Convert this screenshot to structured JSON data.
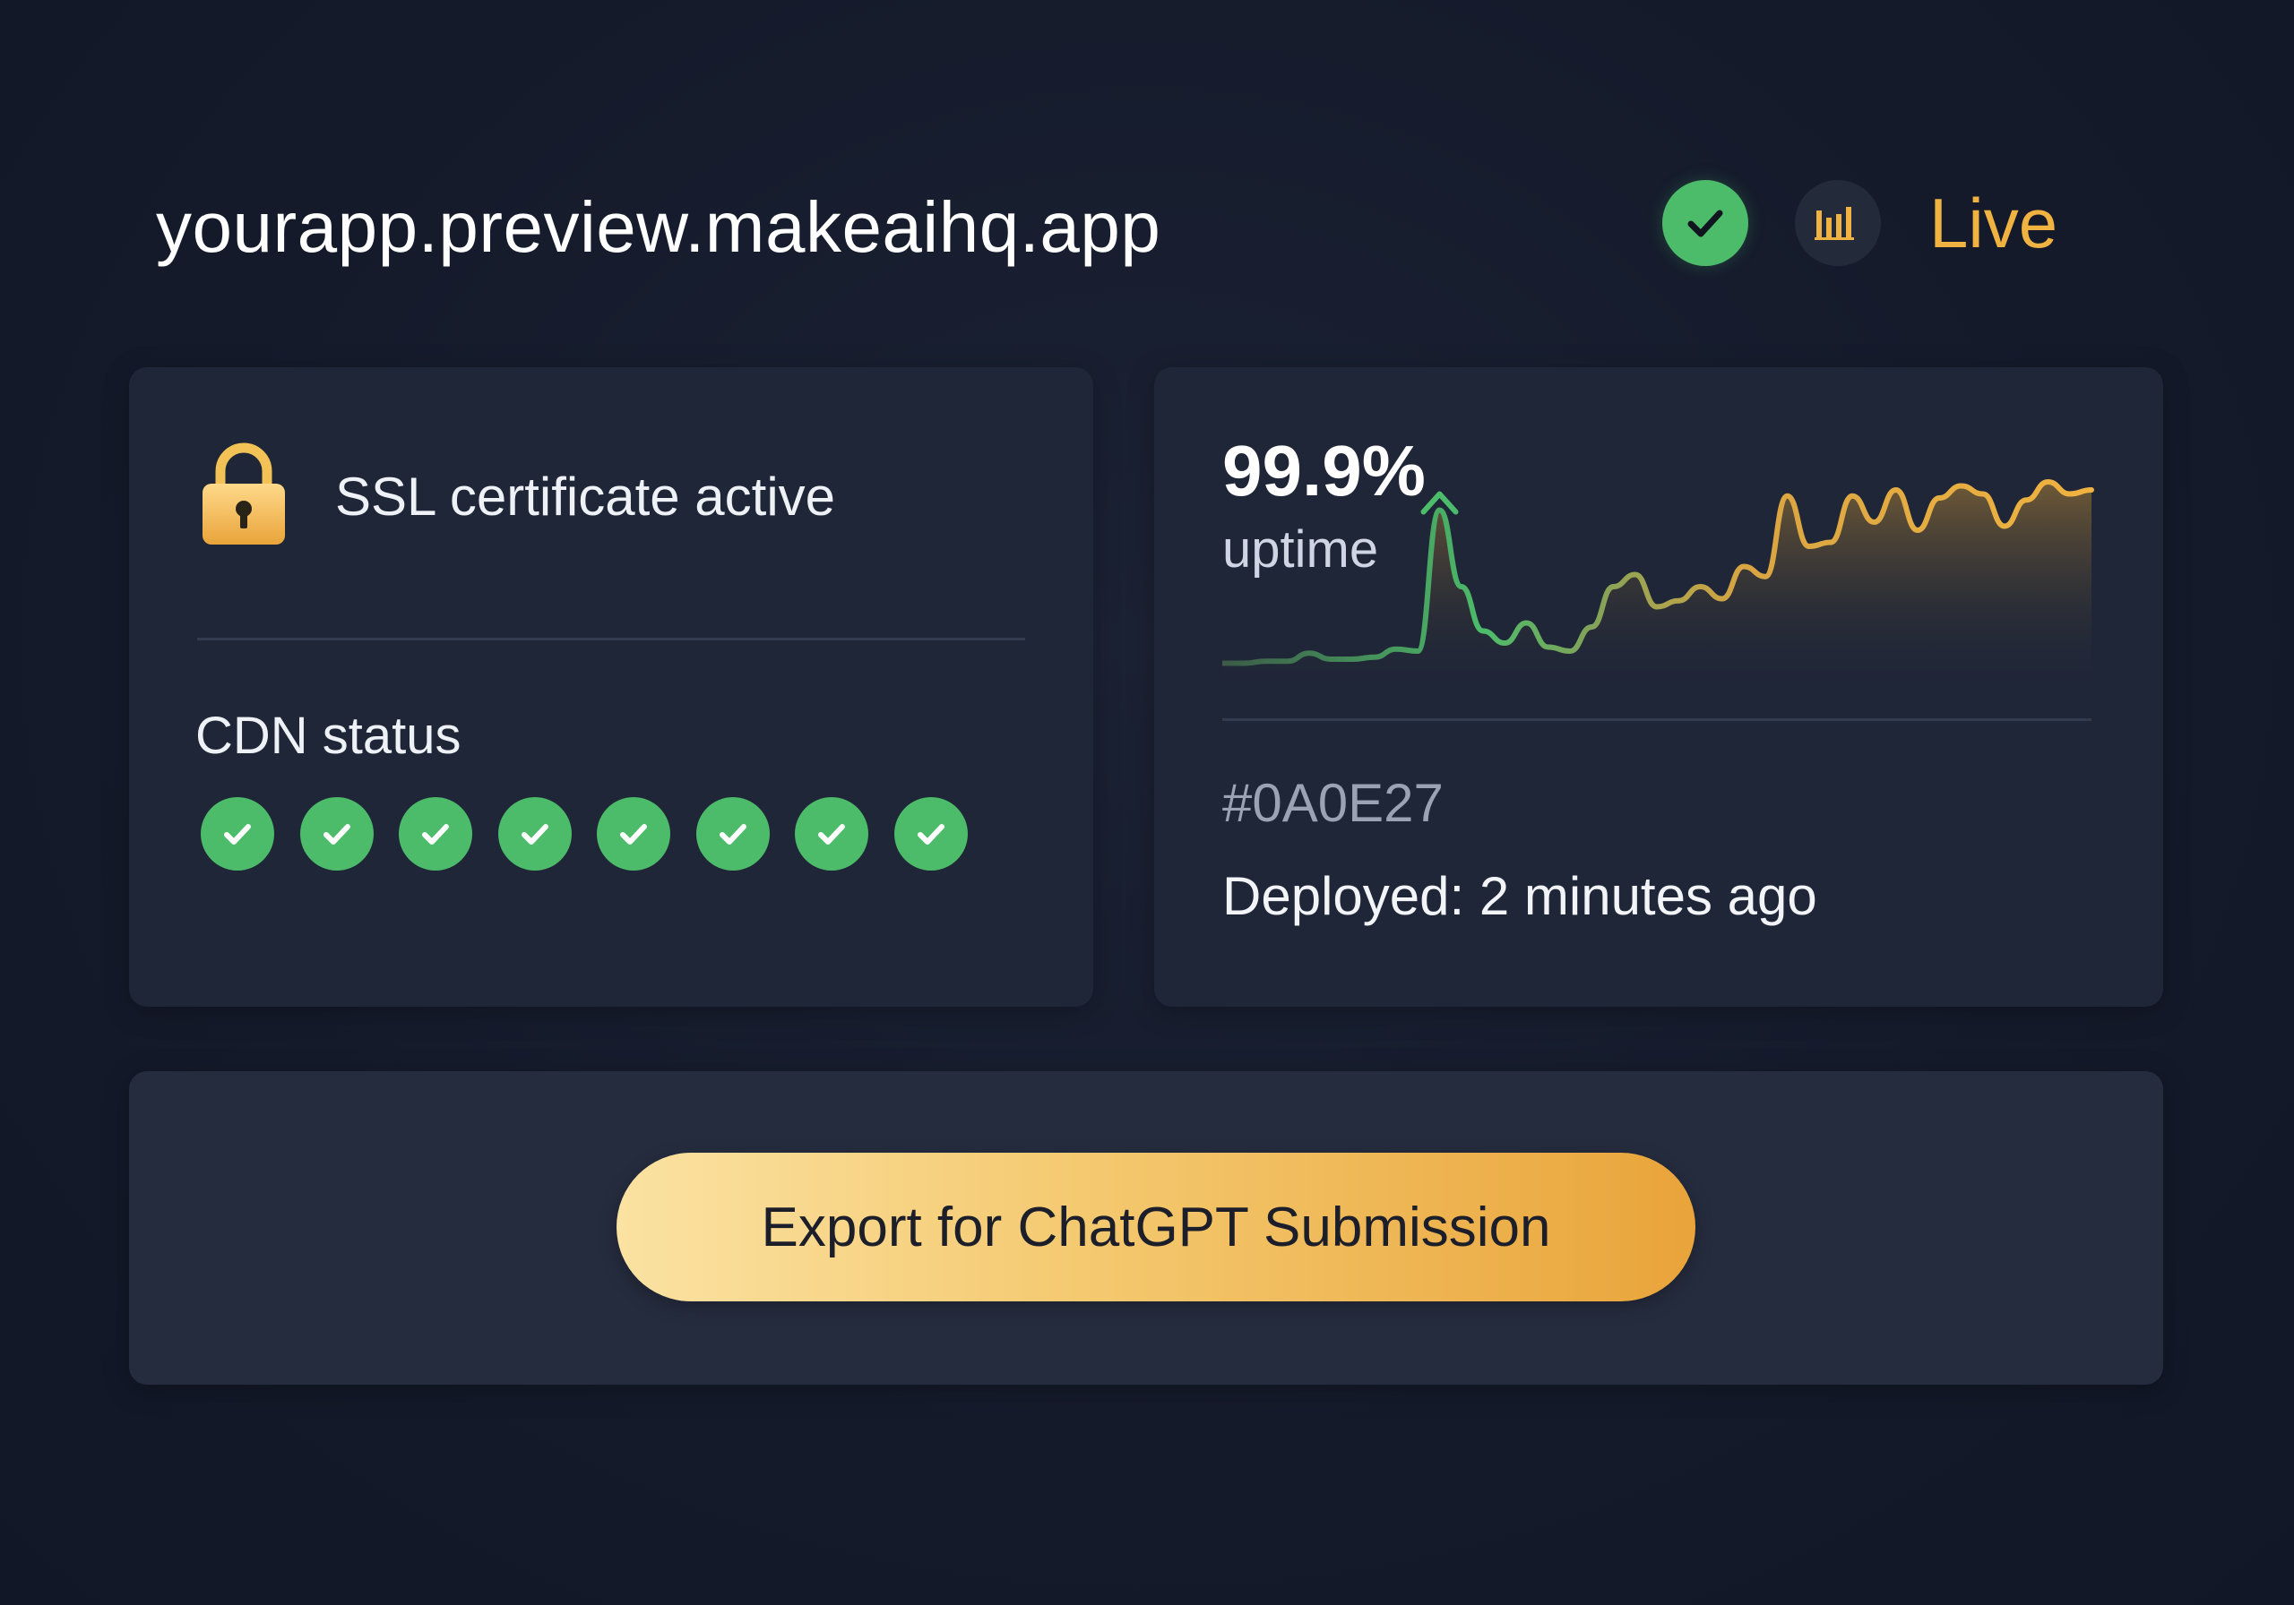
{
  "header": {
    "domain": "yourapp.preview.makeaihq.app",
    "status_icon": "check-circle-icon",
    "signal_icon": "signal-bars-icon",
    "status_label": "Live"
  },
  "colors": {
    "background": "#141a2a",
    "card": "#1f2637",
    "success": "#4cbc6a",
    "accent": "#f0b341",
    "text": "#eef1f6",
    "muted": "#9aa2b4"
  },
  "ssl": {
    "icon": "lock-icon",
    "label": "SSL certificate active"
  },
  "cdn": {
    "title": "CDN status",
    "nodes": [
      "ok",
      "ok",
      "ok",
      "ok",
      "ok",
      "ok",
      "ok",
      "ok"
    ]
  },
  "uptime": {
    "value": "99.9%",
    "label": "uptime"
  },
  "chart_data": {
    "type": "area",
    "title": "",
    "xlabel": "",
    "ylabel": "",
    "x": [
      0,
      1,
      2,
      3,
      4,
      5,
      6,
      7,
      8,
      9,
      10,
      11,
      12,
      13,
      14,
      15,
      16,
      17,
      18,
      19,
      20,
      21,
      22,
      23,
      24,
      25,
      26,
      27,
      28,
      29,
      30,
      31,
      32,
      33,
      34,
      35,
      36,
      37,
      38,
      39,
      40
    ],
    "values": [
      2,
      2,
      3,
      3,
      7,
      4,
      4,
      5,
      9,
      8,
      78,
      40,
      18,
      12,
      22,
      10,
      8,
      20,
      40,
      46,
      30,
      33,
      40,
      34,
      50,
      45,
      85,
      60,
      62,
      85,
      72,
      88,
      68,
      84,
      90,
      86,
      70,
      83,
      92,
      86,
      88
    ],
    "ylim": [
      0,
      100
    ],
    "peak_index": 10,
    "peak_marker": "arrow-up-icon",
    "gradient": [
      "#4cbc6a",
      "#f0b341"
    ],
    "grid": false
  },
  "deploy": {
    "hash": "#0A0E27",
    "deployed_label": "Deployed: 2 minutes ago"
  },
  "actions": {
    "export_label": "Export for ChatGPT Submission"
  }
}
